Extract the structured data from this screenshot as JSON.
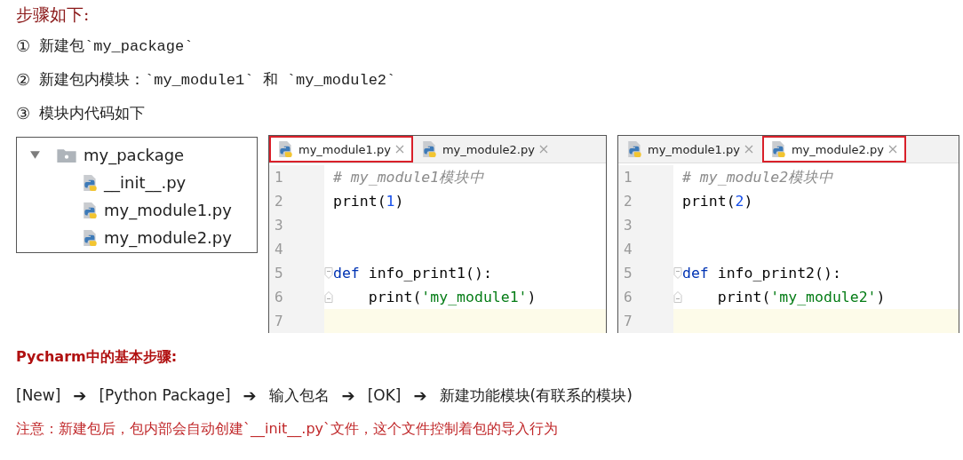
{
  "heading": "步骤如下:",
  "steps": [
    {
      "marker": "①",
      "text": "新建包`my_package`"
    },
    {
      "marker": "②",
      "text": "新建包内模块：`my_module1` 和 `my_module2`"
    },
    {
      "marker": "③",
      "text": "模块内代码如下"
    }
  ],
  "tree": {
    "name": "my_package",
    "expanded": true,
    "children": [
      {
        "name": "__init__.py"
      },
      {
        "name": "my_module1.py"
      },
      {
        "name": "my_module2.py"
      }
    ]
  },
  "editors": [
    {
      "tabs": [
        {
          "label": "my_module1.py",
          "selected": true
        },
        {
          "label": "my_module2.py",
          "selected": false
        }
      ],
      "lines": [
        {
          "number": "1",
          "current": false,
          "fold_start": false,
          "fold_end": false,
          "tokens": [
            {
              "kind": "comment",
              "text": "# my_module1模块中"
            }
          ]
        },
        {
          "number": "2",
          "current": false,
          "fold_start": false,
          "fold_end": false,
          "tokens": [
            {
              "kind": "name",
              "text": "print("
            },
            {
              "kind": "number",
              "text": "1"
            },
            {
              "kind": "name",
              "text": ")"
            }
          ]
        },
        {
          "number": "3",
          "current": false,
          "fold_start": false,
          "fold_end": false
        },
        {
          "number": "4",
          "current": false,
          "fold_start": false,
          "fold_end": false
        },
        {
          "number": "5",
          "current": false,
          "fold_start": true,
          "fold_end": false,
          "tokens": [
            {
              "kind": "keyword",
              "text": "def"
            },
            {
              "kind": "name",
              "text": " info_print1():"
            }
          ]
        },
        {
          "number": "6",
          "current": false,
          "fold_start": false,
          "fold_end": true,
          "tokens": [
            {
              "kind": "name",
              "text": "    print("
            },
            {
              "kind": "string",
              "text": "'my_module1'"
            },
            {
              "kind": "name",
              "text": ")"
            }
          ]
        },
        {
          "number": "7",
          "current": true,
          "fold_start": false,
          "fold_end": false
        }
      ]
    },
    {
      "tabs": [
        {
          "label": "my_module1.py",
          "selected": false
        },
        {
          "label": "my_module2.py",
          "selected": true
        }
      ],
      "lines": [
        {
          "number": "1",
          "current": false,
          "fold_start": false,
          "fold_end": false,
          "tokens": [
            {
              "kind": "comment",
              "text": "# my_module2模块中"
            }
          ]
        },
        {
          "number": "2",
          "current": false,
          "fold_start": false,
          "fold_end": false,
          "tokens": [
            {
              "kind": "name",
              "text": "print("
            },
            {
              "kind": "number",
              "text": "2"
            },
            {
              "kind": "name",
              "text": ")"
            }
          ]
        },
        {
          "number": "3",
          "current": false,
          "fold_start": false,
          "fold_end": false
        },
        {
          "number": "4",
          "current": false,
          "fold_start": false,
          "fold_end": false
        },
        {
          "number": "5",
          "current": false,
          "fold_start": true,
          "fold_end": false,
          "tokens": [
            {
              "kind": "keyword",
              "text": "def"
            },
            {
              "kind": "name",
              "text": " info_print2():"
            }
          ]
        },
        {
          "number": "6",
          "current": false,
          "fold_start": false,
          "fold_end": true,
          "tokens": [
            {
              "kind": "name",
              "text": "    print("
            },
            {
              "kind": "string",
              "text": "'my_module2'"
            },
            {
              "kind": "name",
              "text": ")"
            }
          ]
        },
        {
          "number": "7",
          "current": true,
          "fold_start": false,
          "fold_end": false
        }
      ]
    }
  ],
  "pycharm_heading": "Pycharm中的基本步骤:",
  "flow": [
    {
      "kind": "text",
      "text": "[New]"
    },
    {
      "kind": "arrow",
      "text": "➔"
    },
    {
      "kind": "text",
      "text": "[Python Package]"
    },
    {
      "kind": "arrow",
      "text": "➔"
    },
    {
      "kind": "text",
      "text": "输入包名"
    },
    {
      "kind": "arrow",
      "text": "➔"
    },
    {
      "kind": "text",
      "text": "[OK]"
    },
    {
      "kind": "arrow",
      "text": "➔"
    },
    {
      "kind": "text",
      "text": "新建功能模块(有联系的模块)"
    }
  ],
  "note": "注意：新建包后，包内部会自动创建`__init__.py`文件，这个文件控制着包的导入行为"
}
